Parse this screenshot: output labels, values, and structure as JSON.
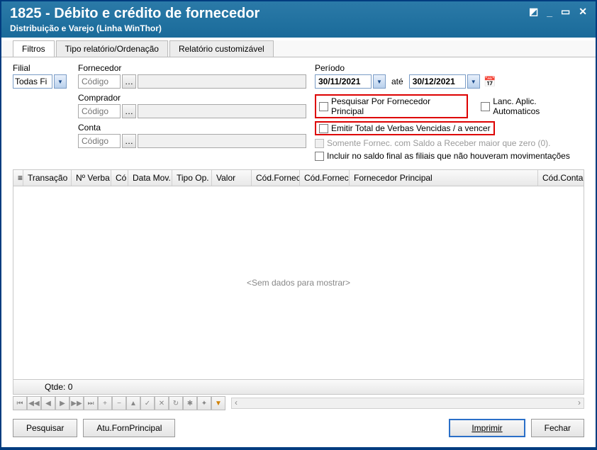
{
  "window": {
    "title": "1825 - Débito e crédito de fornecedor",
    "subtitle": "Distribuição e Varejo (Linha WinThor)"
  },
  "tabs": {
    "filtros": "Filtros",
    "tipo": "Tipo relatório/Ordenação",
    "custom": "Relatório customizável"
  },
  "filters": {
    "filial_label": "Filial",
    "filial_value": "Todas Fi",
    "fornecedor_label": "Fornecedor",
    "fornecedor_placeholder": "Código",
    "comprador_label": "Comprador",
    "comprador_placeholder": "Código",
    "conta_label": "Conta",
    "conta_placeholder": "Código",
    "periodo_label": "Período",
    "date_from": "30/11/2021",
    "date_ate": "até",
    "date_to": "30/12/2021",
    "chk_pesquisar": "Pesquisar Por Fornecedor Principal",
    "chk_lanc": "Lanc. Aplic. Automaticos",
    "chk_emitir": "Emitir Total de  Verbas Vencidas / a vencer",
    "chk_somente": "Somente Fornec. com Saldo a Receber maior que zero (0).",
    "chk_incluir": "Incluir no saldo final as filiais que não houveram movimentações"
  },
  "grid": {
    "headers": {
      "transacao": "Transação",
      "nverba": "Nº Verba",
      "cod": "Có",
      "datamov": "Data Mov.",
      "tipoop": "Tipo Op.",
      "valor": "Valor",
      "codfornec1": "Cód.Fornec",
      "codfornec2": "Cód.Fornec.",
      "fornprincipal": "Fornecedor Principal",
      "codconta": "Cód.Conta"
    },
    "empty": "<Sem dados para mostrar>",
    "qtde_label": "Qtde:",
    "qtde_value": "0"
  },
  "buttons": {
    "pesquisar": "Pesquisar",
    "atu": "Atu.FornPrincipal",
    "imprimir": "Imprimir",
    "fechar": "Fechar"
  }
}
